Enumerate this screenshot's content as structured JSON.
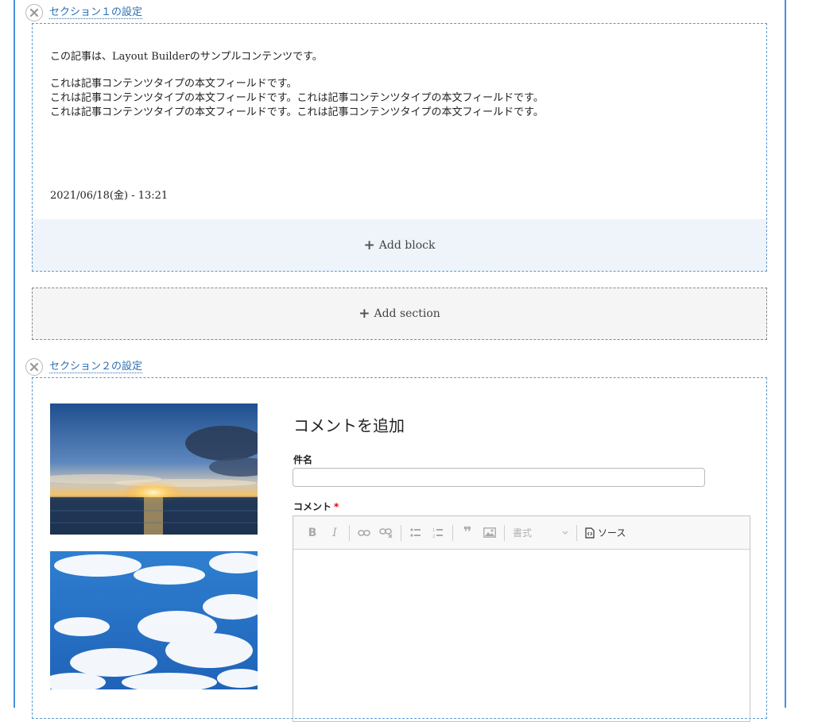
{
  "section1": {
    "configure_label": "セクション１の設定",
    "body": {
      "intro": "この記事は、Layout Builderのサンプルコンテンツです。",
      "lines": [
        "これは記事コンテンツタイプの本文フィールドです。",
        "これは記事コンテンツタイプの本文フィールドです。これは記事コンテンツタイプの本文フィールドです。",
        "これは記事コンテンツタイプの本文フィールドです。これは記事コンテンツタイプの本文フィールドです。"
      ]
    },
    "date": "2021/06/18(金) - 13:21",
    "add_block_label": "Add block"
  },
  "add_section_label": "Add section",
  "section2": {
    "configure_label": "セクション２の設定",
    "comment_form": {
      "title": "コメントを追加",
      "subject_label": "件名",
      "subject_value": "",
      "comment_label": "コメント",
      "required_mark": "*",
      "toolbar": {
        "bold": "B",
        "italic": "I",
        "blockquote": "❞",
        "format_placeholder": "書式",
        "source_label": "ソース"
      }
    }
  },
  "icons": [
    "remove-icon",
    "plus-icon",
    "link-icon",
    "unlink-icon",
    "bulleted-list-icon",
    "numbered-list-icon",
    "blockquote-icon",
    "image-icon",
    "chevron-down-icon",
    "source-icon"
  ],
  "colors": {
    "accent": "#2f6fb0",
    "frame": "#4a90d9",
    "add_block_bg": "#eef4f9",
    "required": "#e00000"
  }
}
